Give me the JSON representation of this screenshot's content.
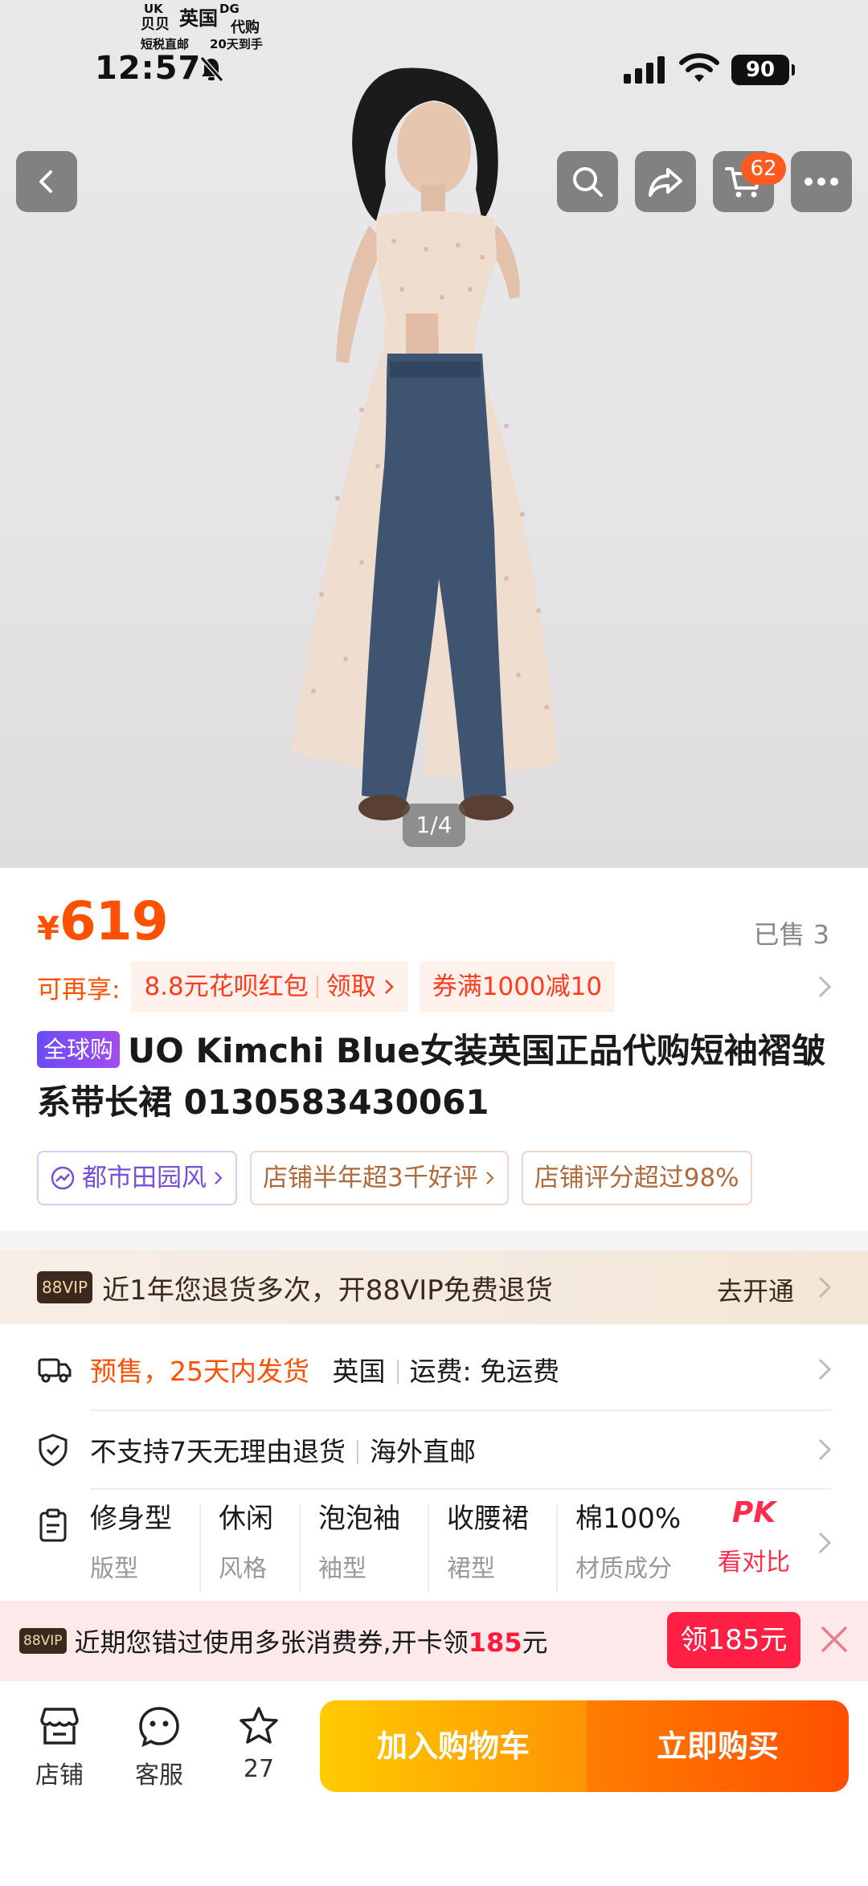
{
  "status": {
    "time": "12:57",
    "battery": "90",
    "watermark": {
      "l1a": "UK",
      "l1b": "DG",
      "l2a": "贝贝",
      "l2b": "英国",
      "l2c": "代购",
      "l3a": "短税直邮",
      "l3b": "20天到手"
    }
  },
  "hero": {
    "page_indicator": "1/4",
    "cart_count": "62"
  },
  "product": {
    "price_symbol": "¥",
    "price": "619",
    "sold": "已售 3",
    "promo_label": "可再享:",
    "promo_huabei": "8.8元花呗红包",
    "promo_claim": "领取",
    "promo_coupon": "券满1000减10",
    "global_tag": "全球购",
    "title": "UO Kimchi Blue女装英国正品代购短袖褶皱系带长裙 0130583430061",
    "tags": [
      "都市田园风",
      "店铺半年超3千好评",
      "店铺评分超过98%"
    ]
  },
  "vip": {
    "badge": "88VIP",
    "text": "近1年您退货多次，开88VIP免费退货",
    "action": "去开通"
  },
  "shipping": {
    "presale": "预售，25天内发货",
    "origin": "英国",
    "fee": "运费: 免运费"
  },
  "returns": {
    "policy": "不支持7天无理由退货",
    "mode": "海外直邮"
  },
  "params": [
    {
      "value": "修身型",
      "key": "版型"
    },
    {
      "value": "休闲",
      "key": "风格"
    },
    {
      "value": "泡泡袖",
      "key": "袖型"
    },
    {
      "value": "收腰裙",
      "key": "裙型"
    },
    {
      "value": "棉100%",
      "key": "材质成分"
    },
    {
      "value": "PK",
      "key": "看对比"
    }
  ],
  "coupon_bar": {
    "badge": "88VIP",
    "text_pre": "近期您错过使用多张消费券,开卡领",
    "amount": "185",
    "text_post": "元",
    "button": "领185元"
  },
  "bottom": {
    "store": "店铺",
    "service": "客服",
    "favorites": "27",
    "add_cart": "加入购物车",
    "buy_now": "立即购买"
  },
  "colors": {
    "accent": "#ff5000",
    "vip_bg": "#f3e6d8",
    "coupon_red": "#ff1f44",
    "cart_yellow": "#ffb300"
  }
}
